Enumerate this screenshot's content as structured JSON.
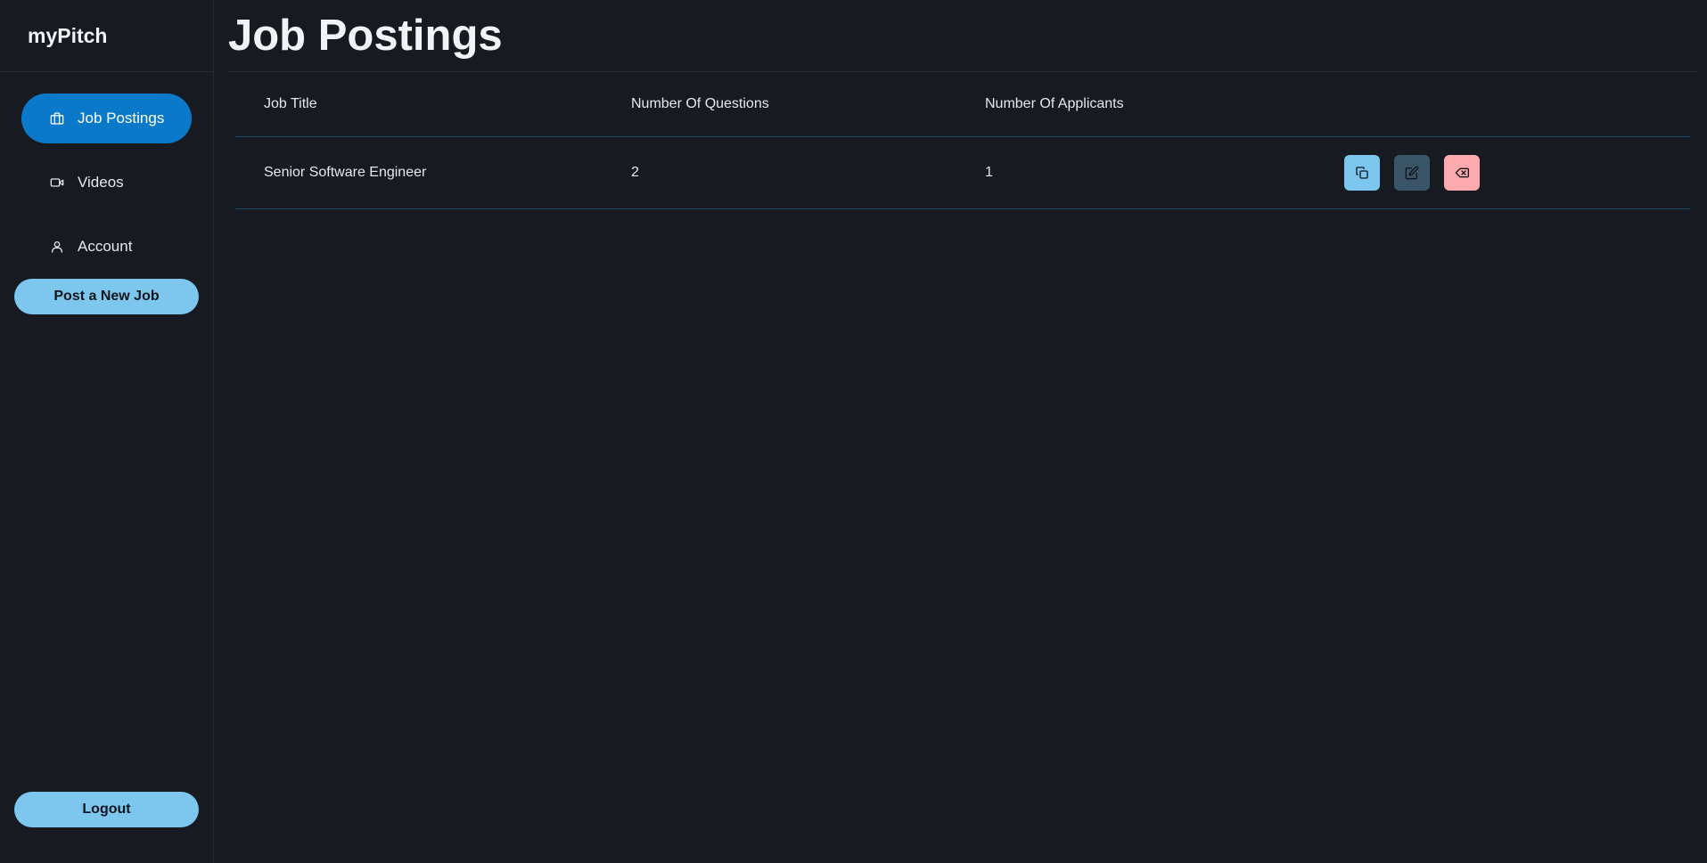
{
  "app": {
    "brand": "myPitch"
  },
  "sidebar": {
    "items": [
      {
        "label": "Job Postings",
        "icon": "briefcase-icon",
        "active": true
      },
      {
        "label": "Videos",
        "icon": "video-icon",
        "active": false
      },
      {
        "label": "Account",
        "icon": "user-icon",
        "active": false
      }
    ],
    "post_job_label": "Post a New Job",
    "logout_label": "Logout"
  },
  "main": {
    "title": "Job Postings",
    "table": {
      "headers": [
        "Job Title",
        "Number Of Questions",
        "Number Of Applicants"
      ],
      "rows": [
        {
          "title": "Senior Software Engineer",
          "questions": "2",
          "applicants": "1"
        }
      ],
      "actions": [
        "copy-icon",
        "edit-icon",
        "delete-icon"
      ]
    }
  },
  "colors": {
    "background": "#171a21",
    "active_nav": "#0a79c9",
    "button": "#7dc7ef",
    "edit_button": "#3b5568",
    "delete_button": "#fdaaaf"
  }
}
